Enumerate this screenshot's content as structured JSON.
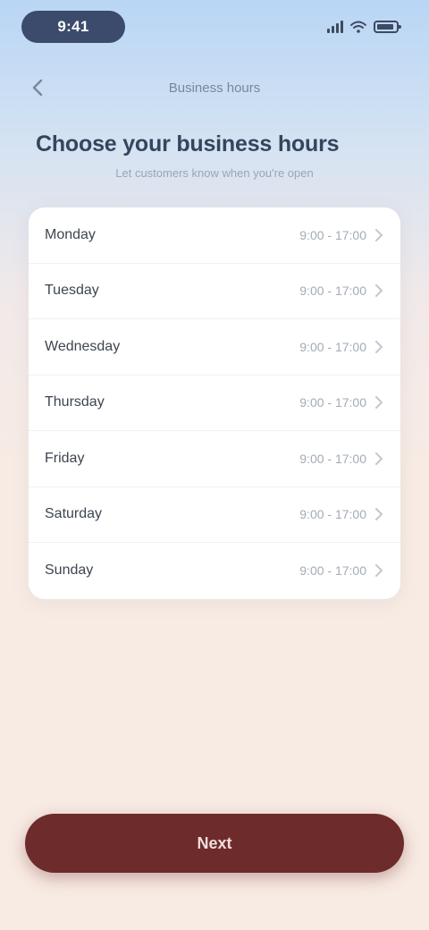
{
  "status_bar": {
    "time": "9:41",
    "icons": [
      "signal-icon",
      "wifi-icon",
      "battery-icon"
    ],
    "pill_color": "#3c4b6b"
  },
  "nav": {
    "back_icon": "chevron-left-icon",
    "title": "Business hours"
  },
  "page": {
    "title": "Choose your business hours",
    "subtitle": "Let customers know when you're open"
  },
  "schedule": {
    "days": [
      {
        "name": "Monday",
        "hours": "9:00 - 17:00"
      },
      {
        "name": "Tuesday",
        "hours": "9:00 - 17:00"
      },
      {
        "name": "Wednesday",
        "hours": "9:00 - 17:00"
      },
      {
        "name": "Thursday",
        "hours": "9:00 - 17:00"
      },
      {
        "name": "Friday",
        "hours": "9:00 - 17:00"
      },
      {
        "name": "Saturday",
        "hours": "9:00 - 17:00"
      },
      {
        "name": "Sunday",
        "hours": "9:00 - 17:00"
      }
    ],
    "row_icon": "chevron-right-icon"
  },
  "actions": {
    "primary_label": "Next",
    "primary_color": "#6e2b2b"
  }
}
